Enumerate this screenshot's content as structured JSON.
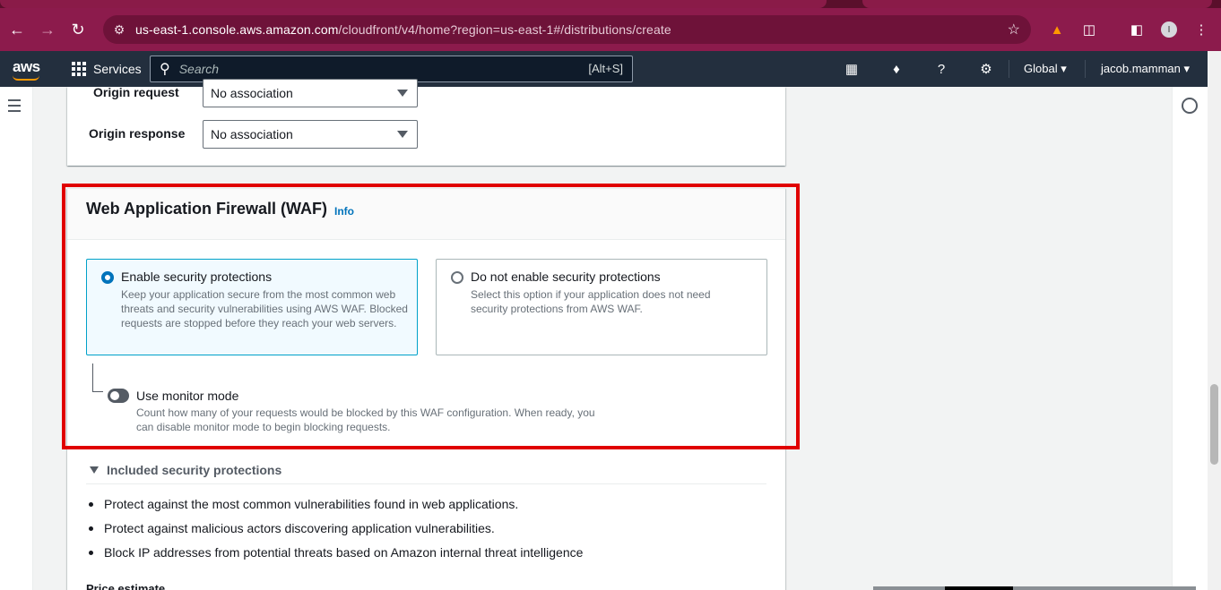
{
  "browser": {
    "url_host": "us-east-1.console.aws.amazon.com",
    "url_path": "/cloudfront/v4/home?region=us-east-1#/distributions/create",
    "profile_initial": "I",
    "icons": [
      "back-arrow-icon",
      "forward-arrow-icon",
      "reload-icon",
      "site-settings-icon",
      "bookmark-star-icon",
      "extension-icon",
      "puzzle-icon",
      "sidebar-icon",
      "kebab-menu-icon"
    ]
  },
  "aws_header": {
    "logo_text": "aws",
    "services_label": "Services",
    "search_placeholder": "Search",
    "search_shortcut": "[Alt+S]",
    "region_label": "Global",
    "account_label": "jacob.mamman"
  },
  "function_associations": {
    "origin_request_label": "Origin request",
    "origin_request_value": "No association",
    "origin_response_label": "Origin response",
    "origin_response_value": "No association"
  },
  "waf": {
    "title": "Web Application Firewall (WAF)",
    "info_link": "Info",
    "options": [
      {
        "title": "Enable security protections",
        "description": "Keep your application secure from the most common web threats and security vulnerabilities using AWS WAF. Blocked requests are stopped before they reach your web servers.",
        "selected": true
      },
      {
        "title": "Do not enable security protections",
        "description": "Select this option if your application does not need security protections from AWS WAF.",
        "selected": false
      }
    ],
    "monitor_mode_label": "Use monitor mode",
    "monitor_mode_description": "Count how many of your requests would be blocked by this WAF configuration. When ready, you can disable monitor mode to begin blocking requests.",
    "monitor_mode_on": false,
    "included_heading": "Included security protections",
    "included_items": [
      "Protect against the most common vulnerabilities found in web applications.",
      "Protect against malicious actors discovering application vulnerabilities.",
      "Block IP addresses from potential threats based on Amazon internal threat intelligence"
    ],
    "price_estimate_label": "Price estimate"
  },
  "colors": {
    "browser_frame": "#8c1b4c",
    "aws_header": "#232f3e",
    "aws_orange": "#ff9900",
    "link_blue": "#0073bb",
    "highlight_red": "#e00000"
  }
}
